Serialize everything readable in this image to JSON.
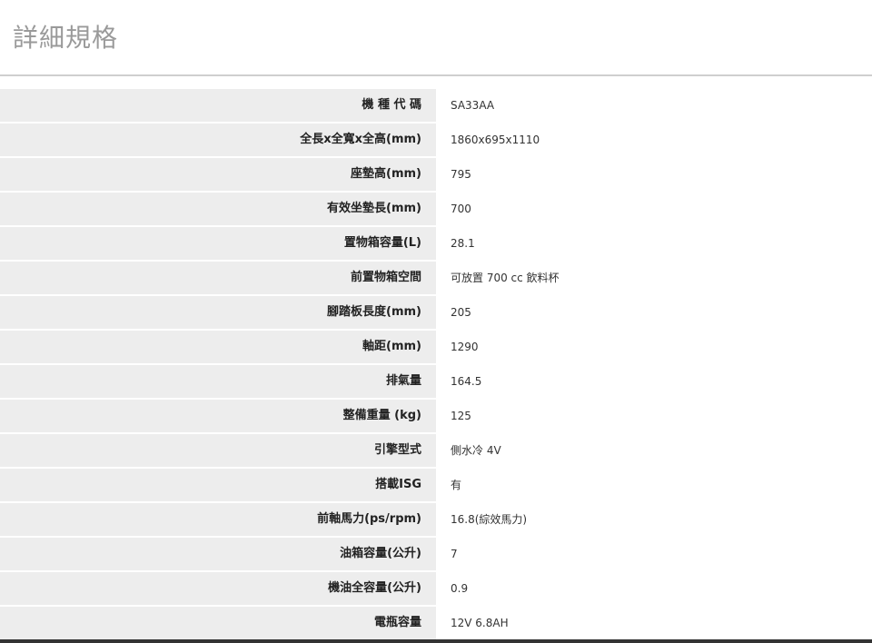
{
  "header": {
    "title": "詳細規格"
  },
  "specs": [
    {
      "label": "機 種 代 碼",
      "value": "SA33AA"
    },
    {
      "label": "全長x全寬x全高(mm)",
      "value": "1860x695x1110"
    },
    {
      "label": "座墊高(mm)",
      "value": "795"
    },
    {
      "label": "有效坐墊長(mm)",
      "value": "700"
    },
    {
      "label": "置物箱容量(L)",
      "value": "28.1"
    },
    {
      "label": "前置物箱空間",
      "value": "可放置 700 cc 飲料杯"
    },
    {
      "label": "腳踏板長度(mm)",
      "value": "205"
    },
    {
      "label": "軸距(mm)",
      "value": "1290"
    },
    {
      "label": "排氣量",
      "value": "164.5"
    },
    {
      "label": "整備重量 (kg)",
      "value": "125"
    },
    {
      "label": "引擎型式",
      "value": "側水冷 4V"
    },
    {
      "label": "搭載ISG",
      "value": "有"
    },
    {
      "label": "前軸馬力(ps/rpm)",
      "value": "16.8(綜效馬力)"
    },
    {
      "label": "油箱容量(公升)",
      "value": "7"
    },
    {
      "label": "機油全容量(公升)",
      "value": "0.9"
    },
    {
      "label": "電瓶容量",
      "value": "12V 6.8AH"
    }
  ]
}
